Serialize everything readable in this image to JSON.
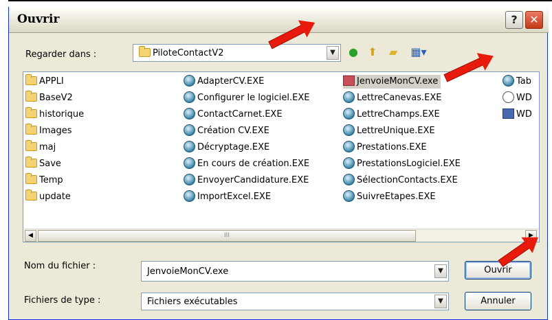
{
  "window": {
    "title": "Ouvrir",
    "help_label": "?",
    "close_label": "✕"
  },
  "lookin": {
    "label": "Regarder dans :",
    "value": "PiloteContactV2"
  },
  "toolbar": {
    "icons": [
      "back-icon",
      "up-folder-icon",
      "new-folder-icon",
      "view-menu-icon"
    ]
  },
  "files": {
    "col1": [
      "APPLI",
      "BaseV2",
      "historique",
      "Images",
      "maj",
      "Save",
      "Temp",
      "update"
    ],
    "col2": [
      "AdapterCV.EXE",
      "Configurer le logiciel.EXE",
      "ContactCarnet.EXE",
      "Création CV.EXE",
      "Décryptage.EXE",
      "En cours de création.EXE",
      "EnvoyerCandidature.EXE",
      "ImportExcel.EXE"
    ],
    "col3": [
      "JenvoieMonCV.exe",
      "LettreCanevas.EXE",
      "LettreChamps.EXE",
      "LettreUnique.EXE",
      "Prestations.EXE",
      "PrestationsLogiciel.EXE",
      "SélectionContacts.EXE",
      "SuivreEtapes.EXE"
    ],
    "col4": [
      "Tab",
      "WD",
      "WD"
    ]
  },
  "filename": {
    "label": "Nom du fichier :",
    "value": "JenvoieMonCV.exe"
  },
  "filetype": {
    "label": "Fichiers de type :",
    "value": "Fichiers exécutables"
  },
  "buttons": {
    "open": "Ouvrir",
    "cancel": "Annuler"
  },
  "scrollbar": {
    "thumb_grip": "III"
  },
  "colors": {
    "arrow": "#e81a0c",
    "titlebar_close": "#c43918",
    "selection": "#d4d0c8"
  }
}
